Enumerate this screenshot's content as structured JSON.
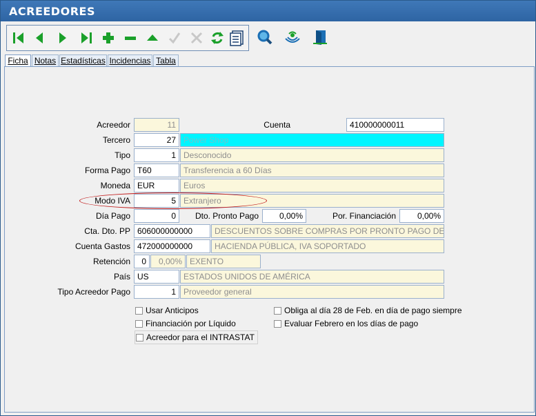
{
  "window": {
    "title": "ACREEDORES"
  },
  "toolbar": {
    "buttons": [
      {
        "name": "first-record-icon"
      },
      {
        "name": "previous-record-icon"
      },
      {
        "name": "next-record-icon"
      },
      {
        "name": "last-record-icon"
      },
      {
        "name": "add-icon"
      },
      {
        "name": "delete-icon"
      },
      {
        "name": "up-icon"
      },
      {
        "name": "confirm-icon"
      },
      {
        "name": "cancel-icon"
      },
      {
        "name": "refresh-icon"
      },
      {
        "name": "list-icon"
      }
    ],
    "extra": [
      {
        "name": "search-icon"
      },
      {
        "name": "signal-icon"
      },
      {
        "name": "exit-door-icon"
      }
    ]
  },
  "tabs": [
    "Ficha",
    "Notas",
    "Estadísticas",
    "Incidencias",
    "Tabla"
  ],
  "form": {
    "acreedor_label": "Acreedor",
    "acreedor_value": "11",
    "cuenta_label": "Cuenta",
    "cuenta_value": "410000000011",
    "tercero_label": "Tercero",
    "tercero_value": "27",
    "tercero_name": "Power Shop",
    "tipo_label": "Tipo",
    "tipo_value": "1",
    "tipo_desc": "Desconocido",
    "forma_pago_label": "Forma Pago",
    "forma_pago_value": "T60",
    "forma_pago_desc": "Transferencia a 60 Días",
    "moneda_label": "Moneda",
    "moneda_value": "EUR",
    "moneda_desc": "Euros",
    "modo_iva_label": "Modo IVA",
    "modo_iva_value": "5",
    "modo_iva_desc": "Extranjero",
    "dia_pago_label": "Día Pago",
    "dia_pago_value": "0",
    "dto_pronto_pago_label": "Dto. Pronto Pago",
    "dto_pronto_pago_value": "0,00%",
    "por_financiacion_label": "Por. Financiación",
    "por_financiacion_value": "0,00%",
    "cta_dto_pp_label": "Cta. Dto. PP",
    "cta_dto_pp_value": "606000000000",
    "cta_dto_pp_desc": "DESCUENTOS SOBRE COMPRAS POR PRONTO PAGO DE MERC",
    "cuenta_gastos_label": "Cuenta Gastos",
    "cuenta_gastos_value": "472000000000",
    "cuenta_gastos_desc": "HACIENDA PÚBLICA, IVA SOPORTADO",
    "retencion_label": "Retención",
    "retencion_value": "0",
    "retencion_pct": "0,00%",
    "retencion_desc": "EXENTO",
    "pais_label": "País",
    "pais_value": "US",
    "pais_desc": "ESTADOS UNIDOS DE AMÉRICA",
    "tipo_acreedor_pago_label": "Tipo Acreedor Pago",
    "tipo_acreedor_pago_value": "1",
    "tipo_acreedor_pago_desc": "Proveedor general"
  },
  "checkboxes": {
    "usar_anticipos": "Usar Anticipos",
    "financiacion_liquido": "Financiación por Líquido",
    "acreedor_intrastat": "Acreedor para el INTRASTAT",
    "obliga_28_feb": "Obliga al día 28 de Feb. en día de pago siempre",
    "evaluar_febrero": "Evaluar Febrero en los días de pago"
  },
  "colors": {
    "accent": "#2e64a3",
    "icon_green": "#1aa02a",
    "icon_blue": "#1b6fb5",
    "highlight": "#c01818"
  }
}
